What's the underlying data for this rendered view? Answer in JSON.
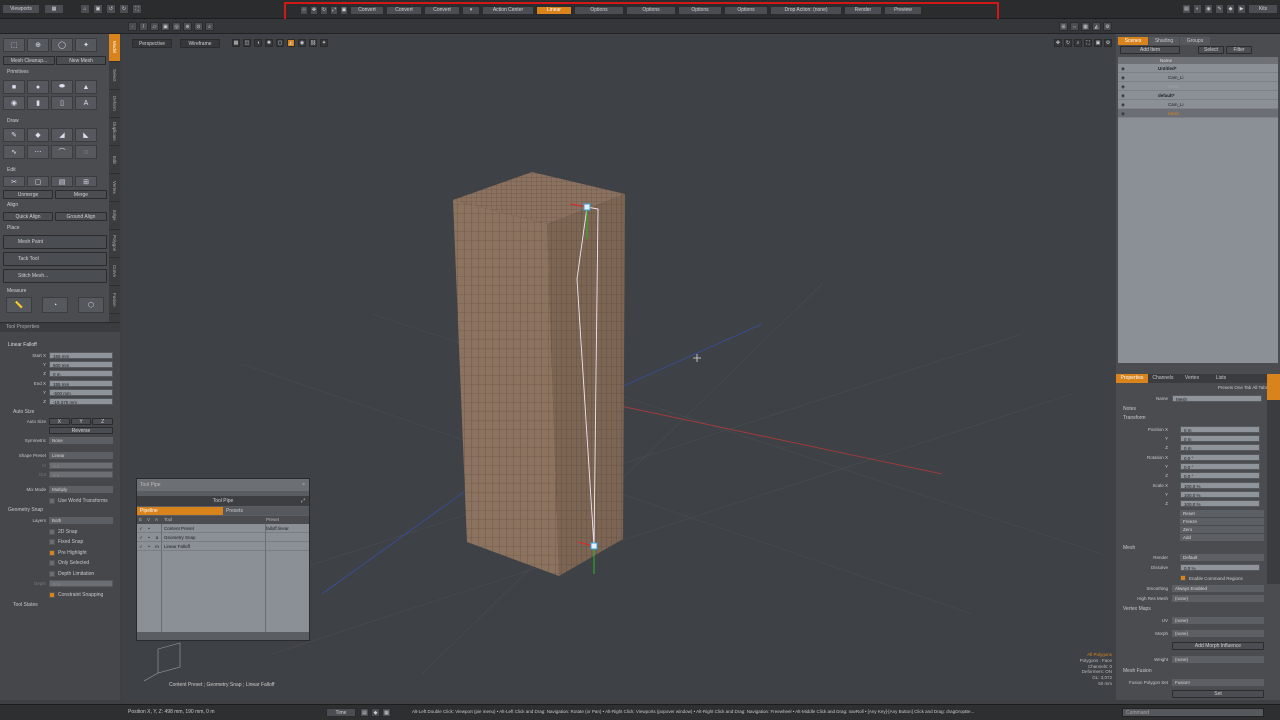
{
  "colors": {
    "accent": "#d9831c",
    "selection": "#d9831c",
    "redbox": "#d01818",
    "mesh": "#8c735f",
    "bg": "#3e4145"
  },
  "topbar": {
    "menu_label": "Viewports",
    "kits_label": "Kits",
    "tools": [
      {
        "label": "Convert"
      },
      {
        "label": "Convert"
      },
      {
        "label": "Convert"
      },
      {
        "label": "Action Center"
      },
      {
        "label": "Linear",
        "active": true
      },
      {
        "label": "Options"
      },
      {
        "label": "Options"
      },
      {
        "label": "Options"
      },
      {
        "label": "Options"
      },
      {
        "label": "Drop Action: (none)"
      },
      {
        "label": "Render"
      },
      {
        "label": "Preview"
      }
    ]
  },
  "left": {
    "tabs": [
      "Model",
      "Select",
      "Deform",
      "Duplicate",
      "Edit",
      "Vertex",
      "Edge",
      "Polygon",
      "Curve",
      "Fusion"
    ],
    "mesh_cleanup": "Mesh Cleanup...",
    "new_mesh": "New Mesh",
    "sections": {
      "primitives": "Primitives",
      "draw": "Draw",
      "edit": "Edit",
      "align": "Align",
      "place": "Place",
      "measure": "Measure"
    },
    "unmerge": "Unmerge",
    "merge": "Merge",
    "quick_align": "Quick Align",
    "ground_align": "Ground Align",
    "mesh_paint": "Mesh Paint",
    "tack_tool": "Tack Tool",
    "stitch_mesh": "Stitch Mesh...",
    "tool_properties": "Tool Properties",
    "linear_falloff": "Linear Falloff",
    "start_label": "Start X",
    "end_label": "End X",
    "start": [
      "155 mm",
      "500 mm",
      "0 m"
    ],
    "end": [
      "155 mm",
      "-500 mm",
      "-19.375 mm"
    ],
    "axis_y": "Y",
    "axis_z": "Z",
    "auto_size_section": "Auto Size",
    "auto_size_label": "Auto Size",
    "auto_size_axes": [
      "X",
      "Y",
      "Z"
    ],
    "reverse": "Reverse",
    "symmetric_label": "Symmetric",
    "symmetric_value": "None",
    "shape_preset_label": "Shape Preset",
    "shape_preset_value": "Linear",
    "in_label": "In",
    "out_label": "Out",
    "in_value": "0.0",
    "out_value": "0.0",
    "mix_mode_label": "Mix Mode",
    "mix_mode_value": "Multiply",
    "use_world_transforms": "Use World Transforms",
    "geometry_snap": "Geometry Snap",
    "layers_label": "Layers",
    "layers_value": "Both",
    "snap_2d": "2D Snap",
    "fixed_snap": "Fixed Snap",
    "pre_highlight": "Pre Highlight",
    "only_selected": "Only Selected",
    "depth_limitation": "Depth Limitation",
    "depth_label": "Depth",
    "depth_value": "0 m",
    "constraint_snapping": "Constraint Snapping",
    "tool_states": "Tool States"
  },
  "viewport": {
    "perspective": "Perspective",
    "wireframe": "Wireframe",
    "info": [
      "All Polygons",
      "Polygons : Face",
      "Channels: 0",
      "Deformers: ON",
      "GL: 3,072",
      "50 mm"
    ],
    "breadcrumb": "Content Preset ; Geometry Snap ; Linear Falloff"
  },
  "toolpipe": {
    "window_title": "Tool Pipe",
    "title": "Tool Pipe",
    "tabs": [
      "Pipeline",
      "Presets"
    ],
    "headers": [
      "E",
      "V",
      "A",
      "Tool",
      "Preset"
    ],
    "rows": [
      {
        "a": "",
        "tool": "Content Preset",
        "preset": "falloff.linear"
      },
      {
        "a": "a",
        "tool": "Geometry Snap",
        "preset": ""
      },
      {
        "a": "m",
        "tool": "Linear Falloff",
        "preset": ""
      }
    ]
  },
  "right": {
    "tabs": [
      "Scenes",
      "Shading",
      "Groups"
    ],
    "add_item": "Add Item",
    "select": "Select",
    "filter": "Filter",
    "name_col": "Name",
    "tree": [
      {
        "label": "Untitled*",
        "indent": 0
      },
      {
        "label": "Cam_Li",
        "indent": 1
      },
      {
        "label": "Mesh",
        "indent": 1,
        "dim": true
      },
      {
        "label": "default*",
        "indent": 0
      },
      {
        "label": "Cam_Li",
        "indent": 1
      },
      {
        "label": "Mesh",
        "indent": 1,
        "selected": true
      }
    ],
    "prop_tabs": [
      "Properties",
      "Channels",
      "Vertex",
      "Lists"
    ],
    "presets": "Presets  One Tab  All Tabs",
    "name_label": "Name",
    "name_value": "Mesh",
    "notes": "Notes",
    "transform": "Transform",
    "position_label": "Position X",
    "rotation_label": "Rotation X",
    "scale_label": "Scale X",
    "axis_y": "Y",
    "axis_z": "Z",
    "position": [
      "0 m",
      "0 m",
      "0 m"
    ],
    "rotation": [
      "0.0 °",
      "0.0 °",
      "0.0 °"
    ],
    "scale": [
      "100.0 %",
      "100.0 %",
      "100.0 %"
    ],
    "actions": [
      "Reset",
      "Freeze",
      "Zero",
      "Add"
    ],
    "mesh_section": "Mesh",
    "render_label": "Render",
    "render_value": "Default",
    "dissolve_label": "Dissolve",
    "dissolve_value": "0.0 %",
    "enable_command_regions": "Enable Command Regions",
    "smoothing_label": "Smoothing",
    "smoothing_value": "Always Enabled",
    "hires_label": "High Res Mesh",
    "hires_value": "(none)",
    "vertex_maps": "Vertex Maps",
    "uv_label": "UV",
    "uv_value": "(none)",
    "morph_label": "Morph",
    "morph_value": "(none)",
    "add_morph": "Add Morph Influence",
    "weight_label": "Weight",
    "weight_value": "(none)",
    "mesh_fusion": "Mesh Fusion",
    "fusion_set_label": "Fusion Polygon Set",
    "fusion_set_value": "Fusion!",
    "set": "Set",
    "command_placeholder": "Command"
  },
  "status": {
    "position": "Position X, Y, Z:  498 mm, 190 mm, 0 m",
    "time": "Time",
    "hint": "Alt-Left Double Click: Viewport (pie menu) • Alt-Left Click and Drag: Navigation: Rotate (or Pan) • Alt-Right Click: Viewports (popover window) • Alt-Right Click and Drag: Navigation: Freewheel • Alt-Middle Click and Drag: navRoll • [Any Key]-[Any Button] Click and Drag: dragDropBe..."
  }
}
